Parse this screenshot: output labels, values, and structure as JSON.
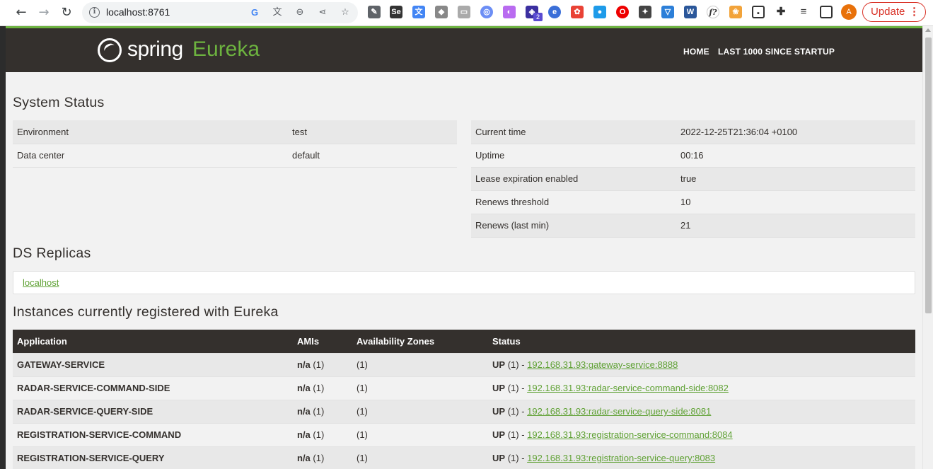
{
  "browser": {
    "url": "localhost:8761",
    "update_label": "Update",
    "avatar_letter": "A",
    "extension_badge": "2"
  },
  "header": {
    "logo_spring": "spring",
    "logo_eureka": "Eureka",
    "nav": [
      "HOME",
      "LAST 1000 SINCE STARTUP"
    ]
  },
  "system_status": {
    "title": "System Status",
    "left": [
      {
        "label": "Environment",
        "value": "test"
      },
      {
        "label": "Data center",
        "value": "default"
      }
    ],
    "right": [
      {
        "label": "Current time",
        "value": "2022-12-25T21:36:04 +0100"
      },
      {
        "label": "Uptime",
        "value": "00:16"
      },
      {
        "label": "Lease expiration enabled",
        "value": "true"
      },
      {
        "label": "Renews threshold",
        "value": "10"
      },
      {
        "label": "Renews (last min)",
        "value": "21"
      }
    ]
  },
  "ds_replicas": {
    "title": "DS Replicas",
    "link": "localhost"
  },
  "instances": {
    "title": "Instances currently registered with Eureka",
    "columns": [
      "Application",
      "AMIs",
      "Availability Zones",
      "Status"
    ],
    "rows": [
      {
        "app": "GATEWAY-SERVICE",
        "ami": "n/a",
        "ami_count": "(1)",
        "zones": "(1)",
        "status": "UP",
        "status_count": "(1) -",
        "link": "192.168.31.93:gateway-service:8888"
      },
      {
        "app": "RADAR-SERVICE-COMMAND-SIDE",
        "ami": "n/a",
        "ami_count": "(1)",
        "zones": "(1)",
        "status": "UP",
        "status_count": "(1) -",
        "link": "192.168.31.93:radar-service-command-side:8082"
      },
      {
        "app": "RADAR-SERVICE-QUERY-SIDE",
        "ami": "n/a",
        "ami_count": "(1)",
        "zones": "(1)",
        "status": "UP",
        "status_count": "(1) -",
        "link": "192.168.31.93:radar-service-query-side:8081"
      },
      {
        "app": "REGISTRATION-SERVICE-COMMAND",
        "ami": "n/a",
        "ami_count": "(1)",
        "zones": "(1)",
        "status": "UP",
        "status_count": "(1) -",
        "link": "192.168.31.93:registration-service-command:8084"
      },
      {
        "app": "REGISTRATION-SERVICE-QUERY",
        "ami": "n/a",
        "ami_count": "(1)",
        "zones": "(1)",
        "status": "UP",
        "status_count": "(1) -",
        "link": "192.168.31.93:registration-service-query:8083"
      }
    ]
  },
  "colors": {
    "spring_green": "#6db33f",
    "header_bg": "#34302d",
    "link_green": "#5fa134"
  }
}
